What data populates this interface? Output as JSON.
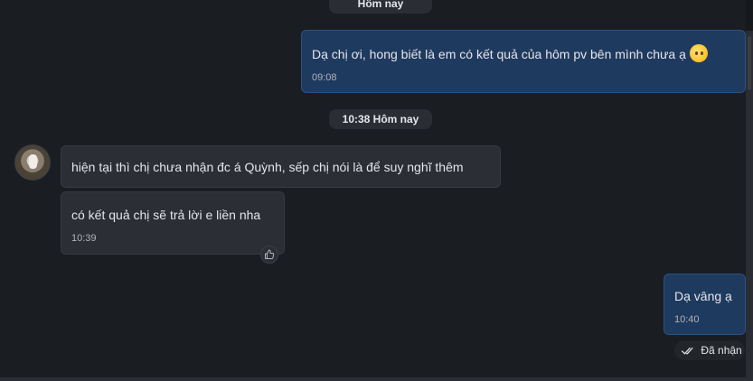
{
  "date_pills": {
    "top": "Hôm nay",
    "mid": "10:38 Hôm nay"
  },
  "messages": [
    {
      "direction": "outgoing",
      "text": "Dạ chị ơi, hong biết là em có kết quả của hôm pv bên mình chưa ạ",
      "emoji": "pleading-face",
      "time": "09:08"
    },
    {
      "direction": "incoming",
      "text": "hiện tại thì chị chưa nhận đc á Quỳnh, sếp chị nói là để suy nghĩ thêm",
      "time": ""
    },
    {
      "direction": "incoming",
      "text": "có kết quả chị sẽ trả lời e liền nha",
      "time": "10:39",
      "reaction": "thumbs-up-icon"
    },
    {
      "direction": "outgoing",
      "text": "Dạ vâng ạ",
      "time": "10:40"
    }
  ],
  "status": {
    "label": "Đã nhận",
    "icon": "double-check-icon"
  },
  "colors": {
    "background": "#1a1d22",
    "outgoing_bubble": "#1f3a5f",
    "incoming_bubble": "#2b2e34"
  }
}
